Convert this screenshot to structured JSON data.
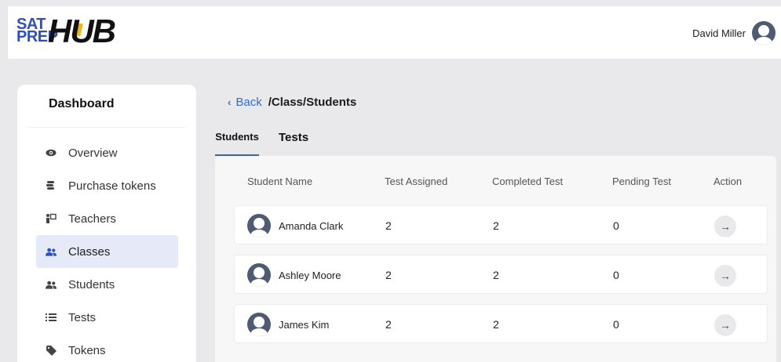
{
  "header": {
    "logo_sat": "SAT",
    "logo_prep": "PREP",
    "logo_hub": "HUB",
    "user_name": "David Miller"
  },
  "sidebar": {
    "title": "Dashboard",
    "items": [
      {
        "label": "Overview",
        "icon": "eye-icon"
      },
      {
        "label": "Purchase tokens",
        "icon": "coins-icon"
      },
      {
        "label": "Teachers",
        "icon": "teacher-icon"
      },
      {
        "label": "Classes",
        "icon": "users-icon",
        "active": true
      },
      {
        "label": "Students",
        "icon": "users-icon"
      },
      {
        "label": "Tests",
        "icon": "list-icon"
      },
      {
        "label": "Tokens",
        "icon": "tag-icon"
      }
    ]
  },
  "breadcrumb": {
    "back_label": "Back",
    "path": "/Class/Students"
  },
  "tabs": [
    {
      "label": "Students",
      "active": true
    },
    {
      "label": "Tests"
    }
  ],
  "table": {
    "columns": [
      "Student Name",
      "Test Assigned",
      "Completed Test",
      "Pending Test",
      "Action"
    ],
    "rows": [
      {
        "name": "Amanda Clark",
        "assigned": "2",
        "completed": "2",
        "pending": "0"
      },
      {
        "name": "Ashley Moore",
        "assigned": "2",
        "completed": "2",
        "pending": "0"
      },
      {
        "name": "James Kim",
        "assigned": "2",
        "completed": "2",
        "pending": "0"
      }
    ]
  },
  "colors": {
    "accent": "#2f4fbf",
    "link": "#2f6fd6",
    "active_bg": "#e6e9f7",
    "logo_yellow": "#f3b31b"
  }
}
